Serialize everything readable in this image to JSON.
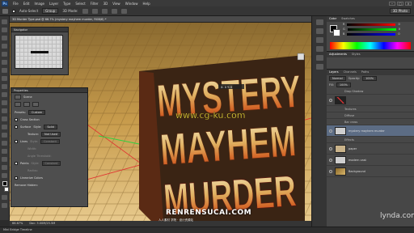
{
  "menubar": {
    "logo": "Ps",
    "items": [
      "File",
      "Edit",
      "Image",
      "Layer",
      "Type",
      "Select",
      "Filter",
      "3D",
      "View",
      "Window",
      "Help"
    ],
    "window_controls": [
      "–",
      "□",
      "×"
    ]
  },
  "options": {
    "auto_select": "Auto-Select",
    "group": "Group",
    "mode": "3D Mode:",
    "workspace": "3D Photo"
  },
  "document": {
    "tab_title": "3D Murder Type.psd @ 66.7% (mystery mayhem murder, RGB/8) *",
    "zoom": "66.67%",
    "doc_size": "Doc: 3.00M/25.5M"
  },
  "canvas": {
    "word1": "MYSTERY",
    "word2": "MAYHEM",
    "word3": "MURDER",
    "watermark_mid": "www.cg-ku.com",
    "coord_readout": "X: 0  Y: 0"
  },
  "navigator": {
    "title": "Navigator"
  },
  "properties": {
    "title": "Properties",
    "mode_label": "Scene",
    "presets_label": "Presets:",
    "presets_value": "Custom",
    "cross_section": "Cross Section",
    "surface": "Surface",
    "surface_style": "Style:",
    "surface_style_value": "Solid",
    "texture_label": "Texture:",
    "texture_value": "Not Used",
    "lines": "Lines",
    "lines_style": "Style:",
    "lines_style_value": "Constant",
    "width_label": "Width:",
    "angle_label": "Angle Threshold:",
    "points": "Points",
    "points_style": "Style:",
    "points_style_value": "Constant",
    "radius_label": "Radius:",
    "linearize": "Linearize Colors",
    "remove_hidden": "Remove Hidden:"
  },
  "color_panel": {
    "tabs": [
      "Color",
      "Swatches"
    ],
    "channels": [
      {
        "name": "R",
        "value": "0"
      },
      {
        "name": "G",
        "value": "0"
      },
      {
        "name": "B",
        "value": "0"
      }
    ]
  },
  "adjustments": {
    "tabs": [
      "Adjustments",
      "Styles"
    ]
  },
  "layers": {
    "tabs": [
      "Layers",
      "Channels",
      "Paths"
    ],
    "blend_mode": "Normal",
    "opacity_label": "Opacity:",
    "opacity_value": "100%",
    "fill_label": "Fill:",
    "fill_value": "100%",
    "rows": [
      {
        "name": "Drop Shadow",
        "sub": true
      },
      {
        "name": "",
        "sub": false,
        "thumb": "t-x"
      },
      {
        "name": "Textures",
        "sub": true
      },
      {
        "name": "Diffuse",
        "sub": true
      },
      {
        "name": "Bar cross",
        "sub": true
      },
      {
        "name": "mystery mayhem murder",
        "sub": false,
        "thumb": "t-light",
        "selected": true
      },
      {
        "name": "Effects",
        "sub": true
      },
      {
        "name": "paper",
        "sub": false,
        "thumb": "t-paper"
      },
      {
        "name": "modern cast",
        "sub": false,
        "thumb": "t-light"
      },
      {
        "name": "Background",
        "sub": false,
        "thumb": "t-gold"
      }
    ]
  },
  "timeline": {
    "label": "Mini Bridge  Timeline"
  },
  "watermarks": {
    "lynda": "lynda.com",
    "renren": "RENRENSUCAI.COM",
    "renren_sub": "人人素材 学院 · 设计资源站"
  }
}
